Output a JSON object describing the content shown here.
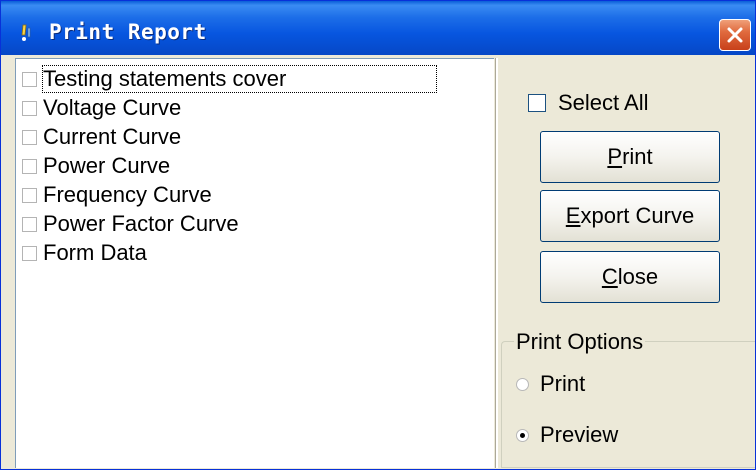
{
  "window": {
    "title": "Print Report",
    "title_icon": "app-icon",
    "close_icon": "close-icon"
  },
  "report_items": [
    {
      "label": "Testing statements cover",
      "checked": false,
      "focused": true
    },
    {
      "label": "Voltage Curve",
      "checked": false
    },
    {
      "label": "Current Curve",
      "checked": false
    },
    {
      "label": "Power Curve",
      "checked": false
    },
    {
      "label": "Frequency Curve",
      "checked": false
    },
    {
      "label": "Power Factor Curve",
      "checked": false
    },
    {
      "label": "Form Data",
      "checked": false
    }
  ],
  "select_all": {
    "label": "Select All",
    "checked": false
  },
  "buttons": {
    "print": {
      "mnemonic": "P",
      "rest": "rint"
    },
    "export": {
      "mnemonic": "E",
      "rest": "xport Curve"
    },
    "close": {
      "mnemonic": "C",
      "rest": "lose"
    }
  },
  "print_options": {
    "legend": "Print Options",
    "options": [
      {
        "label": "Print",
        "selected": false
      },
      {
        "label": "Preview",
        "selected": true
      }
    ]
  },
  "colors": {
    "titlebar": "#0756e0",
    "dialog_bg": "#ece9d8",
    "close_button": "#e06a3e"
  }
}
